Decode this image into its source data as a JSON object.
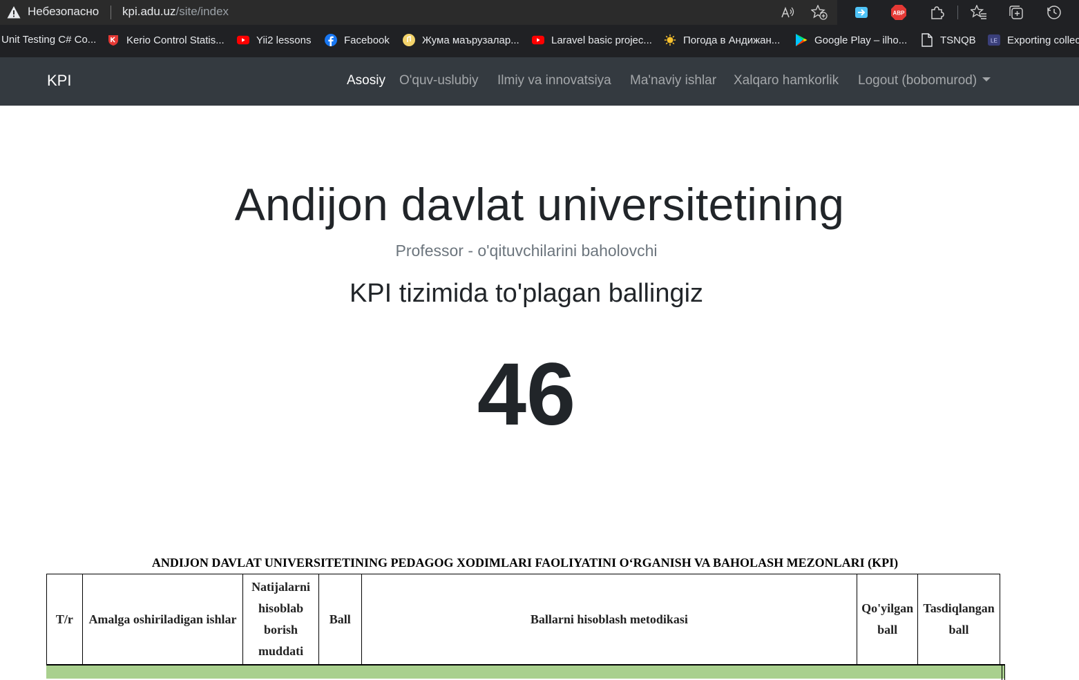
{
  "browser": {
    "security_label": "Небезопасно",
    "url_host": "kpi.adu.uz",
    "url_path": "/site/index",
    "bookmarks": [
      {
        "label": "Unit Testing C# Co..."
      },
      {
        "label": "Kerio Control Statis..."
      },
      {
        "label": "Yii2 lessons"
      },
      {
        "label": "Facebook"
      },
      {
        "label": "Жума маърузалар..."
      },
      {
        "label": "Laravel basic projec..."
      },
      {
        "label": "Погода в Андижан..."
      },
      {
        "label": "Google Play – ilho..."
      },
      {
        "label": "TSNQB"
      },
      {
        "label": "Exporting collec"
      }
    ],
    "abp_badge": "ABP",
    "le_badge": "LE"
  },
  "navbar": {
    "brand": "KPI",
    "links": [
      {
        "label": "Asosiy"
      },
      {
        "label": "O'quv-uslubiy"
      },
      {
        "label": "Ilmiy va innovatsiya"
      },
      {
        "label": "Ma'naviy ishlar"
      },
      {
        "label": "Xalqaro hamkorlik"
      },
      {
        "label": "Logout (bobomurod)"
      }
    ]
  },
  "hero": {
    "title": "Andijon davlat universitetining",
    "subtitle": "Professor - o'qituvchilarini baholovchi",
    "heading": "KPI tizimida to'plagan ballingiz",
    "score": "46"
  },
  "kpi_table": {
    "title": "ANDIJON DAVLAT UNIVERSITETINING PEDAGOG XODIMLARI FAOLIYATINI O‘RGANISH VA BAHOLASH MEZONLARI (KPI)",
    "headers": [
      "T/r",
      "Amalga oshiriladigan ishlar",
      "Natijalarni hisoblab borish muddati",
      "Ball",
      "Ballarni hisoblash metodikasi",
      "Qo'yilgan ball",
      "Tasdiqlangan ball"
    ],
    "section_color": "#a9d08e"
  },
  "colors": {
    "navbar_bg": "#343a40",
    "browser_bg": "#202124"
  }
}
